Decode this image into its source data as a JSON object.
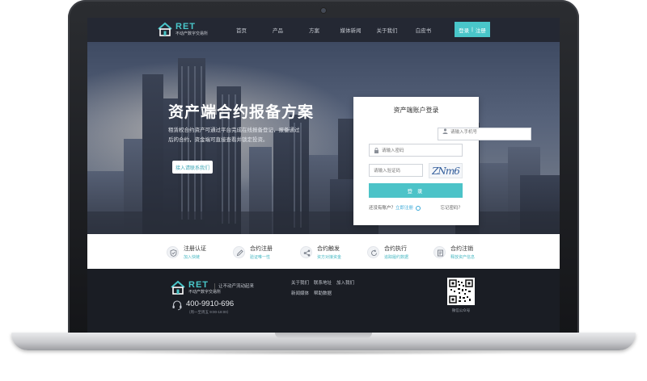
{
  "brand": {
    "logo_text": "RET",
    "logo_subtitle": "不动产数字交易所",
    "accent_color": "#49c6c9"
  },
  "nav": {
    "items": [
      "首页",
      "产品",
      "方案",
      "媒体新闻",
      "关于我们",
      "白皮书"
    ],
    "login_label": "登录",
    "separator": "|",
    "register_label": "注册"
  },
  "hero": {
    "title": "资产端合约报备方案",
    "description": "租赁权合约资产可通过平台完成在线报备登记，报备通过后的合约，资金端可直接查看并锁定投资。",
    "cta_label": "接入请联系我们"
  },
  "login": {
    "title": "资产端账户登录",
    "phone_placeholder": "请输入手机号",
    "password_placeholder": "请输入密码",
    "code_placeholder": "请输入验证码",
    "captcha_text": "ZNm6",
    "submit_label": "登 录",
    "no_account_text": "还没有账户？",
    "register_link": "立即注册",
    "forgot_link": "忘记密码？"
  },
  "features": [
    {
      "name": "注册认证",
      "sub": "加入快链",
      "icon": "shield-check-icon"
    },
    {
      "name": "合约注册",
      "sub": "验证唯一性",
      "icon": "pencil-icon"
    },
    {
      "name": "合约触发",
      "sub": "资方对接资金",
      "icon": "share-icon"
    },
    {
      "name": "合约执行",
      "sub": "追踪履约数据",
      "icon": "refresh-icon"
    },
    {
      "name": "合约注销",
      "sub": "释放资产信息",
      "icon": "document-icon"
    }
  ],
  "footer": {
    "slogan": "让不动产流动起来",
    "phone": "400-9910-696",
    "hours": "（周一至周五 9:00-18:00）",
    "links": [
      "关于我们",
      "联系地址",
      "加入我们",
      "新闻媒体",
      "帮助数据"
    ],
    "qr_label": "微信公众号"
  }
}
